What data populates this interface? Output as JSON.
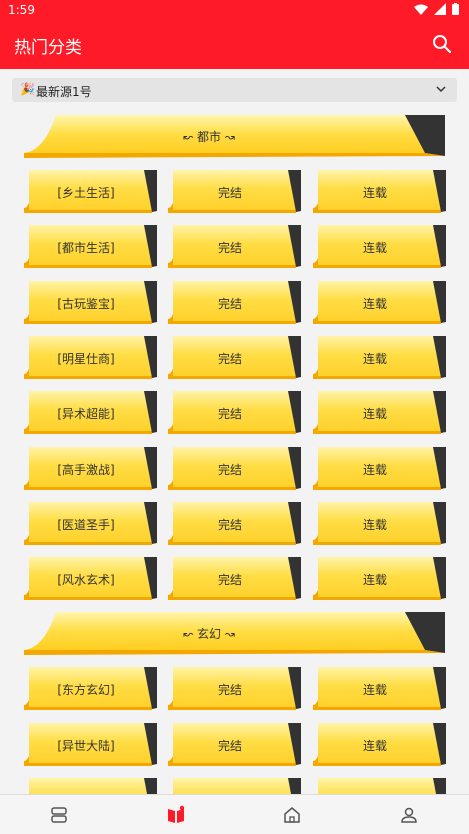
{
  "status_bar": {
    "time": "1:59"
  },
  "app_bar": {
    "title": "热门分类"
  },
  "source_select": {
    "icon": "party-popper-icon",
    "label": "最新源1号"
  },
  "sections": [
    {
      "header": "↜ 都市 ↝",
      "rows": [
        [
          "[乡土生活]",
          "完结",
          "连载"
        ],
        [
          "[都市生活]",
          "完结",
          "连载"
        ],
        [
          "[古玩鉴宝]",
          "完结",
          "连载"
        ],
        [
          "[明星仕商]",
          "完结",
          "连载"
        ],
        [
          "[异术超能]",
          "完结",
          "连载"
        ],
        [
          "[高手激战]",
          "完结",
          "连载"
        ],
        [
          "[医道圣手]",
          "完结",
          "连载"
        ],
        [
          "[风水玄术]",
          "完结",
          "连载"
        ]
      ]
    },
    {
      "header": "↜ 玄幻 ↝",
      "rows": [
        [
          "[东方玄幻]",
          "完结",
          "连载"
        ],
        [
          "[异世大陆]",
          "完结",
          "连载"
        ],
        [
          "",
          "",
          ""
        ]
      ]
    }
  ],
  "bottom_nav": [
    "bookshelf-icon",
    "category-icon",
    "home-icon",
    "profile-icon"
  ],
  "colors": {
    "accent": "#ff1a27",
    "tile_yellow": "#ffd83a",
    "tile_edge": "#f2a800",
    "tile_corner": "#333333"
  }
}
